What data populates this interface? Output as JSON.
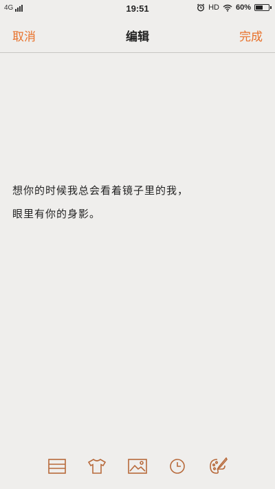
{
  "status_bar": {
    "network": "4G",
    "time": "19:51",
    "hd": "HD",
    "battery_text": "60%",
    "battery_level": 0.6
  },
  "header": {
    "cancel": "取消",
    "title": "编辑",
    "done": "完成"
  },
  "note": {
    "lines": [
      "想你的时候我总会看着镜子里的我，",
      "眼里有你的身影。"
    ]
  },
  "toolbar": {
    "icons": [
      "list-icon",
      "shirt-icon",
      "image-icon",
      "clock-icon",
      "palette-icon"
    ]
  },
  "colors": {
    "accent": "#e8712a",
    "icon": "#b7693a",
    "background": "#efeeec"
  }
}
